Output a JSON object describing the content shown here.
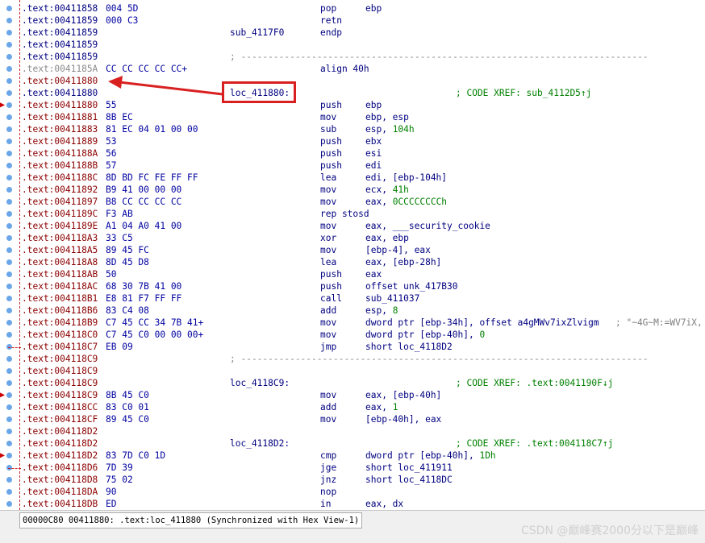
{
  "colors": {
    "address": "#000080",
    "address_red": "#8b0000",
    "opcode_bytes": "#0000a0",
    "number": "#008000",
    "xref_comment": "#008000",
    "annotation": "#d92020",
    "breakpoint_dot": "#6aa6e8"
  },
  "annotation": {
    "callout_target_label": "loc_411880:",
    "arrow_points_to_address": ".text:00411880"
  },
  "listing": [
    {
      "addr": ".text:00411858",
      "bytes": "004 5D",
      "label": "",
      "mnem": "pop",
      "ops": "ebp",
      "num": "",
      "xref": "",
      "cmt": ""
    },
    {
      "addr": ".text:00411859",
      "bytes": "000 C3",
      "label": "",
      "mnem": "retn",
      "ops": "",
      "num": "",
      "xref": "",
      "cmt": ""
    },
    {
      "addr": ".text:00411859",
      "bytes": "",
      "label": "sub_4117F0",
      "mnem": "endp",
      "ops": "",
      "num": "",
      "xref": "",
      "cmt": ""
    },
    {
      "addr": ".text:00411859",
      "bytes": "",
      "label": "",
      "mnem": "",
      "ops": "",
      "num": "",
      "xref": "",
      "cmt": ""
    },
    {
      "addr": ".text:00411859",
      "bytes": "",
      "label": "",
      "mnem": "",
      "ops": "",
      "num": "",
      "xref": "",
      "cmt": "",
      "sep": "; ---------------------------------------------------------------------------"
    },
    {
      "addr": ".text:0041185A",
      "bytes": "CC CC CC CC CC+",
      "label": "",
      "mnem": "align 40h",
      "ops": "",
      "num": "",
      "xref": "",
      "cmt": "",
      "gray": true
    },
    {
      "addr": ".text:00411880",
      "bytes": "",
      "label": "",
      "mnem": "",
      "ops": "",
      "num": "",
      "xref": "",
      "cmt": "",
      "red": true
    },
    {
      "addr": ".text:00411880",
      "bytes": "",
      "label": "loc_411880:",
      "mnem": "",
      "ops": "",
      "num": "",
      "xref": "; CODE XREF: sub_4112D5↑j",
      "cmt": ""
    },
    {
      "addr": ".text:00411880",
      "bytes": "55",
      "label": "",
      "mnem": "push",
      "ops": "ebp",
      "num": "",
      "xref": "",
      "cmt": "",
      "red": true
    },
    {
      "addr": ".text:00411881",
      "bytes": "8B EC",
      "label": "",
      "mnem": "mov",
      "ops": "ebp, esp",
      "num": "",
      "xref": "",
      "cmt": "",
      "red": true
    },
    {
      "addr": ".text:00411883",
      "bytes": "81 EC 04 01 00 00",
      "label": "",
      "mnem": "sub",
      "ops": "esp, ",
      "num": "104h",
      "xref": "",
      "cmt": "",
      "red": true
    },
    {
      "addr": ".text:00411889",
      "bytes": "53",
      "label": "",
      "mnem": "push",
      "ops": "ebx",
      "num": "",
      "xref": "",
      "cmt": "",
      "red": true
    },
    {
      "addr": ".text:0041188A",
      "bytes": "56",
      "label": "",
      "mnem": "push",
      "ops": "esi",
      "num": "",
      "xref": "",
      "cmt": "",
      "red": true
    },
    {
      "addr": ".text:0041188B",
      "bytes": "57",
      "label": "",
      "mnem": "push",
      "ops": "edi",
      "num": "",
      "xref": "",
      "cmt": "",
      "red": true
    },
    {
      "addr": ".text:0041188C",
      "bytes": "8D BD FC FE FF FF",
      "label": "",
      "mnem": "lea",
      "ops": "edi, [ebp-104h]",
      "num": "",
      "xref": "",
      "cmt": "",
      "red": true
    },
    {
      "addr": ".text:00411892",
      "bytes": "B9 41 00 00 00",
      "label": "",
      "mnem": "mov",
      "ops": "ecx, ",
      "num": "41h",
      "xref": "",
      "cmt": "",
      "red": true
    },
    {
      "addr": ".text:00411897",
      "bytes": "B8 CC CC CC CC",
      "label": "",
      "mnem": "mov",
      "ops": "eax, ",
      "num": "0CCCCCCCCh",
      "xref": "",
      "cmt": "",
      "red": true
    },
    {
      "addr": ".text:0041189C",
      "bytes": "F3 AB",
      "label": "",
      "mnem": "rep stosd",
      "ops": "",
      "num": "",
      "xref": "",
      "cmt": "",
      "red": true
    },
    {
      "addr": ".text:0041189E",
      "bytes": "A1 04 A0 41 00",
      "label": "",
      "mnem": "mov",
      "ops": "eax, ___security_cookie",
      "num": "",
      "xref": "",
      "cmt": "",
      "red": true
    },
    {
      "addr": ".text:004118A3",
      "bytes": "33 C5",
      "label": "",
      "mnem": "xor",
      "ops": "eax, ebp",
      "num": "",
      "xref": "",
      "cmt": "",
      "red": true
    },
    {
      "addr": ".text:004118A5",
      "bytes": "89 45 FC",
      "label": "",
      "mnem": "mov",
      "ops": "[ebp-4], eax",
      "num": "",
      "xref": "",
      "cmt": "",
      "red": true
    },
    {
      "addr": ".text:004118A8",
      "bytes": "8D 45 D8",
      "label": "",
      "mnem": "lea",
      "ops": "eax, [ebp-28h]",
      "num": "",
      "xref": "",
      "cmt": "",
      "red": true
    },
    {
      "addr": ".text:004118AB",
      "bytes": "50",
      "label": "",
      "mnem": "push",
      "ops": "eax",
      "num": "",
      "xref": "",
      "cmt": "",
      "red": true
    },
    {
      "addr": ".text:004118AC",
      "bytes": "68 30 7B 41 00",
      "label": "",
      "mnem": "push",
      "ops": "offset unk_417B30",
      "num": "",
      "xref": "",
      "cmt": "",
      "red": true
    },
    {
      "addr": ".text:004118B1",
      "bytes": "E8 81 F7 FF FF",
      "label": "",
      "mnem": "call",
      "ops": "sub_411037",
      "num": "",
      "xref": "",
      "cmt": "",
      "red": true
    },
    {
      "addr": ".text:004118B6",
      "bytes": "83 C4 08",
      "label": "",
      "mnem": "add",
      "ops": "esp, ",
      "num": "8",
      "xref": "",
      "cmt": "",
      "red": true
    },
    {
      "addr": ".text:004118B9",
      "bytes": "C7 45 CC 34 7B 41+",
      "label": "",
      "mnem": "mov",
      "ops": "dword ptr [ebp-34h], offset a4gMWv7ixZlvigm",
      "num": "",
      "xref": "",
      "cmt": "; \"~4G~M:=WV7iX,",
      "red": true
    },
    {
      "addr": ".text:004118C0",
      "bytes": "C7 45 C0 00 00 00+",
      "label": "",
      "mnem": "mov",
      "ops": "dword ptr [ebp-40h], ",
      "num": "0",
      "xref": "",
      "cmt": "",
      "red": true
    },
    {
      "addr": ".text:004118C7",
      "bytes": "EB 09",
      "label": "",
      "mnem": "jmp",
      "ops": "short loc_4118D2",
      "num": "",
      "xref": "",
      "cmt": "",
      "red": true
    },
    {
      "addr": ".text:004118C9",
      "bytes": "",
      "label": "",
      "mnem": "",
      "ops": "",
      "num": "",
      "xref": "",
      "cmt": "",
      "red": true,
      "sep": "; ---------------------------------------------------------------------------"
    },
    {
      "addr": ".text:004118C9",
      "bytes": "",
      "label": "",
      "mnem": "",
      "ops": "",
      "num": "",
      "xref": "",
      "cmt": "",
      "red": true
    },
    {
      "addr": ".text:004118C9",
      "bytes": "",
      "label": "loc_4118C9:",
      "mnem": "",
      "ops": "",
      "num": "",
      "xref": "; CODE XREF: .text:0041190F↓j",
      "cmt": "",
      "red": true
    },
    {
      "addr": ".text:004118C9",
      "bytes": "8B 45 C0",
      "label": "",
      "mnem": "mov",
      "ops": "eax, [ebp-40h]",
      "num": "",
      "xref": "",
      "cmt": "",
      "red": true
    },
    {
      "addr": ".text:004118CC",
      "bytes": "83 C0 01",
      "label": "",
      "mnem": "add",
      "ops": "eax, ",
      "num": "1",
      "xref": "",
      "cmt": "",
      "red": true
    },
    {
      "addr": ".text:004118CF",
      "bytes": "89 45 C0",
      "label": "",
      "mnem": "mov",
      "ops": "[ebp-40h], eax",
      "num": "",
      "xref": "",
      "cmt": "",
      "red": true
    },
    {
      "addr": ".text:004118D2",
      "bytes": "",
      "label": "",
      "mnem": "",
      "ops": "",
      "num": "",
      "xref": "",
      "cmt": "",
      "red": true
    },
    {
      "addr": ".text:004118D2",
      "bytes": "",
      "label": "loc_4118D2:",
      "mnem": "",
      "ops": "",
      "num": "",
      "xref": "; CODE XREF: .text:004118C7↑j",
      "cmt": "",
      "red": true
    },
    {
      "addr": ".text:004118D2",
      "bytes": "83 7D C0 1D",
      "label": "",
      "mnem": "cmp",
      "ops": "dword ptr [ebp-40h], ",
      "num": "1Dh",
      "xref": "",
      "cmt": "",
      "red": true
    },
    {
      "addr": ".text:004118D6",
      "bytes": "7D 39",
      "label": "",
      "mnem": "jge",
      "ops": "short loc_411911",
      "num": "",
      "xref": "",
      "cmt": "",
      "red": true
    },
    {
      "addr": ".text:004118D8",
      "bytes": "75 02",
      "label": "",
      "mnem": "jnz",
      "ops": "short loc_4118DC",
      "num": "",
      "xref": "",
      "cmt": "",
      "red": true
    },
    {
      "addr": ".text:004118DA",
      "bytes": "90",
      "label": "",
      "mnem": "nop",
      "ops": "",
      "num": "",
      "xref": "",
      "cmt": "",
      "red": true
    },
    {
      "addr": ".text:004118DB",
      "bytes": "ED",
      "label": "",
      "mnem": "in",
      "ops": "eax, dx",
      "num": "",
      "xref": "",
      "cmt": "",
      "red": true
    }
  ],
  "status_bar": {
    "text": "00000C80 00411880: .text:loc_411880 (Synchronized with Hex View-1)"
  },
  "watermark": "CSDN @巅峰赛2000分以下是巅峰"
}
